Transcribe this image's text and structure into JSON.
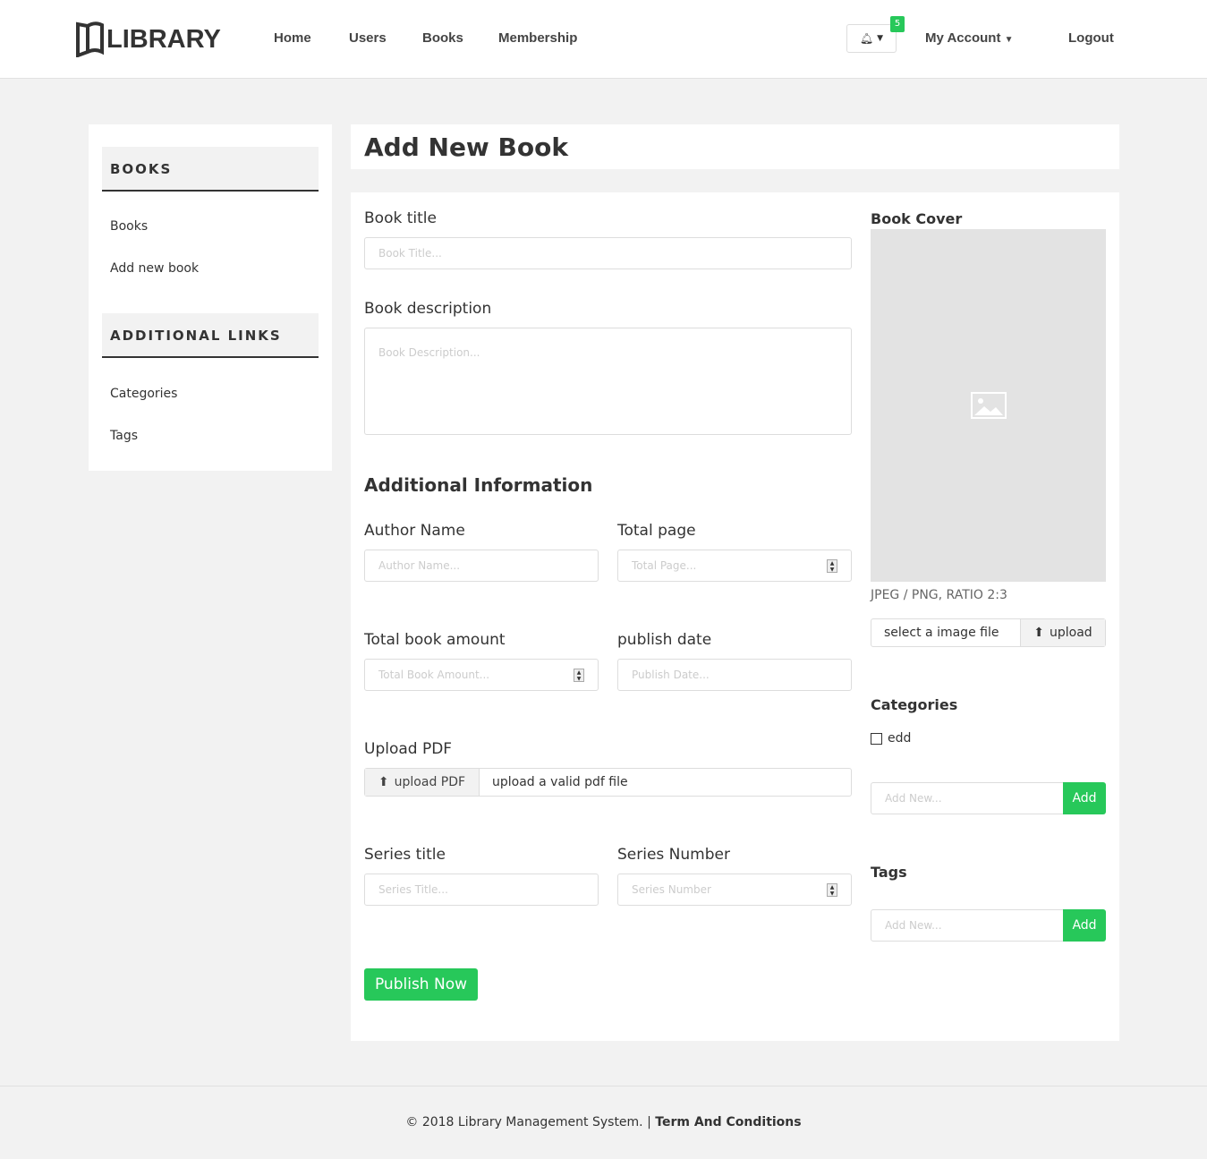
{
  "header": {
    "logo": "LIBRARY",
    "nav": [
      "Home",
      "Users",
      "Books",
      "Membership"
    ],
    "notifications_count": "5",
    "account": "My Account",
    "logout": "Logout"
  },
  "sidebar": {
    "books_heading": "BOOKS",
    "books_links": [
      "Books",
      "Add new book"
    ],
    "additional_heading": "ADDITIONAL LINKS",
    "additional_links": [
      "Categories",
      "Tags"
    ]
  },
  "page_title": "Add New Book",
  "form": {
    "book_title": {
      "label": "Book title",
      "placeholder": "Book Title..."
    },
    "book_description": {
      "label": "Book description",
      "placeholder": "Book Description..."
    },
    "additional_heading": "Additional Information",
    "author_name": {
      "label": "Author Name",
      "placeholder": "Author Name..."
    },
    "total_page": {
      "label": "Total page",
      "placeholder": "Total Page..."
    },
    "total_book_amount": {
      "label": "Total book amount",
      "placeholder": "Total Book Amount..."
    },
    "publish_date": {
      "label": "publish date",
      "placeholder": "Publish Date..."
    },
    "upload_pdf": {
      "label": "Upload PDF",
      "button": "upload PDF",
      "hint": "upload a valid pdf file"
    },
    "series_title": {
      "label": "Series title",
      "placeholder": "Series Title..."
    },
    "series_number": {
      "label": "Series Number",
      "placeholder": "Series Number"
    },
    "publish_button": "Publish Now"
  },
  "cover": {
    "heading": "Book Cover",
    "format_hint": "JPEG / PNG, RATIO 2:3",
    "file_text": "select a image file",
    "upload_button": "upload"
  },
  "categories": {
    "heading": "Categories",
    "items": [
      {
        "label": "edd",
        "checked": false
      }
    ],
    "add_placeholder": "Add New...",
    "add_button": "Add"
  },
  "tags": {
    "heading": "Tags",
    "add_placeholder": "Add New...",
    "add_button": "Add"
  },
  "footer": {
    "copyright": "© 2018 Library Management System. |",
    "terms": "Term And Conditions"
  },
  "colors": {
    "accent": "#27c85a"
  }
}
